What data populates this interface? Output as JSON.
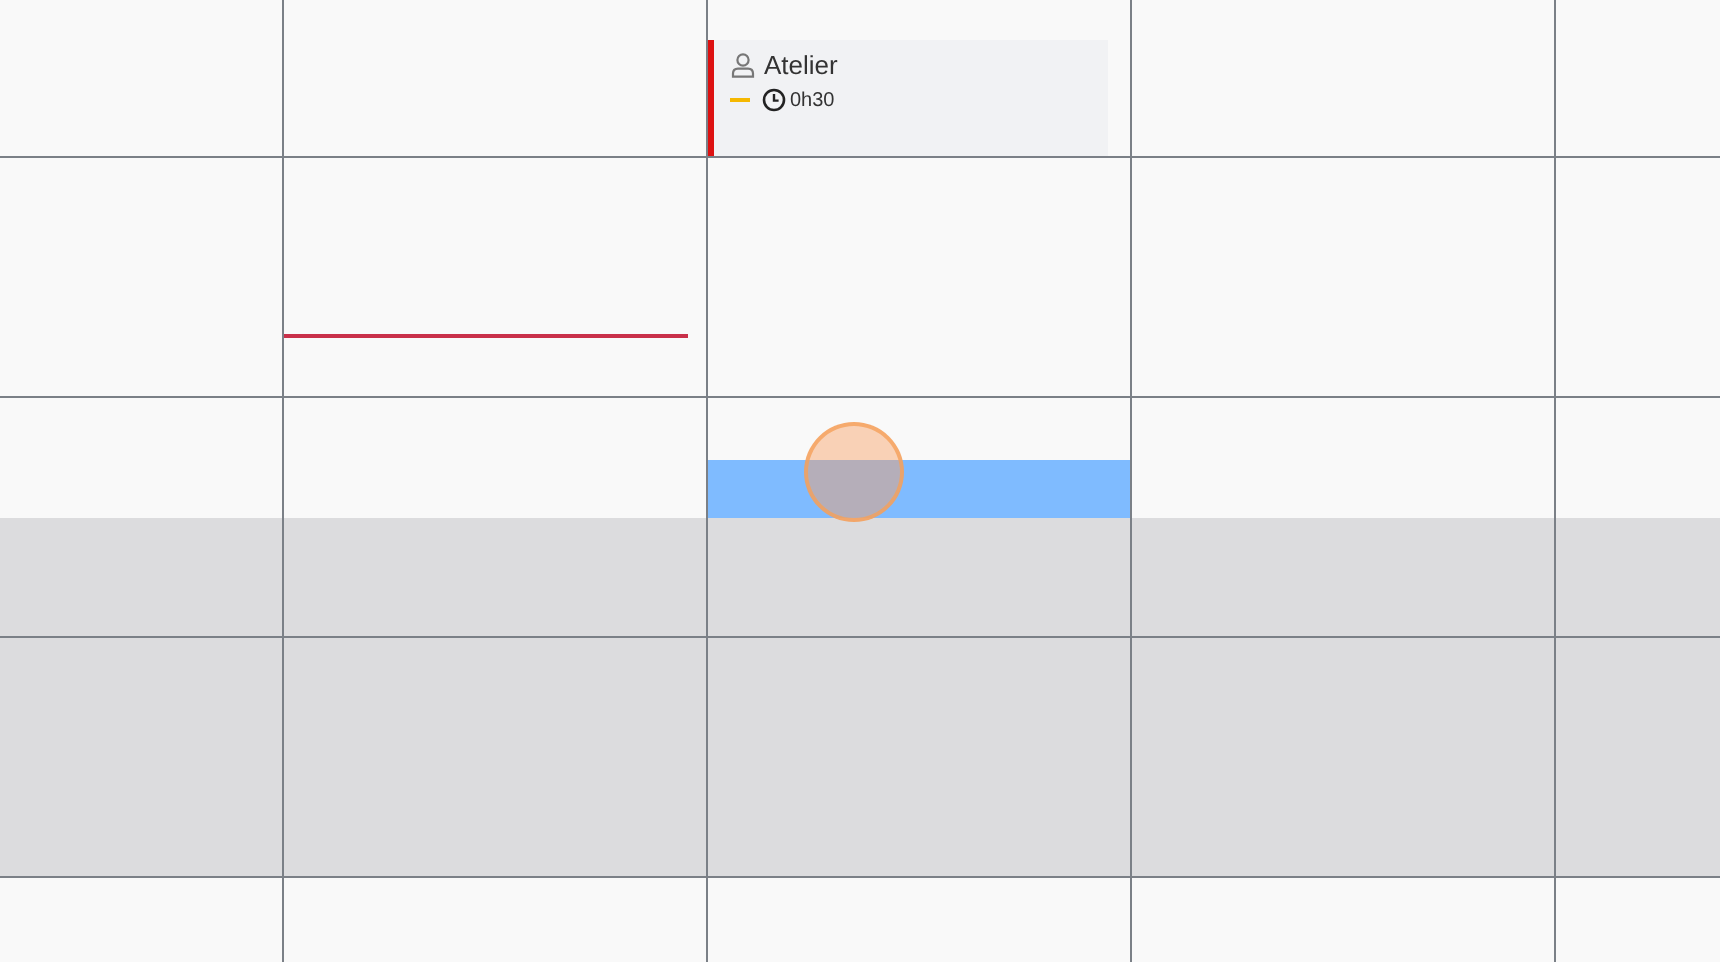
{
  "slots": [
    {
      "shaded": false
    },
    {
      "shaded": false
    },
    {
      "shaded": false
    },
    {
      "shaded": false
    },
    {
      "shaded": false
    },
    {
      "shaded": true
    },
    {
      "shaded": true
    },
    {
      "shaded": true
    },
    {
      "shaded": false
    }
  ],
  "event": {
    "title": "Atelier",
    "duration": "0h30",
    "color": "#dd1111",
    "status": {
      "color": "#f5b800"
    }
  }
}
